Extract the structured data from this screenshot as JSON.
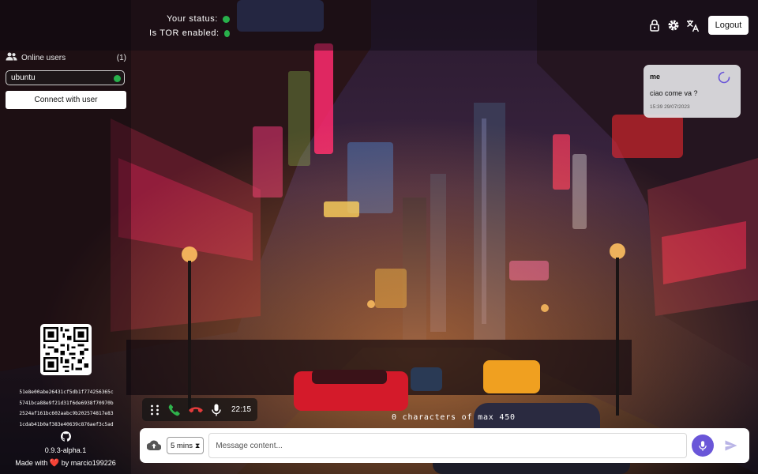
{
  "status": {
    "your_status_label": "Your status:",
    "tor_label": "Is TOR enabled:",
    "status_color": "#28b04b"
  },
  "header": {
    "icons": [
      "lock-icon",
      "gear-icon",
      "translate-icon"
    ],
    "logout_label": "Logout"
  },
  "sidebar": {
    "online_users_label": "Online users",
    "online_users_count": "(1)",
    "users": [
      {
        "name": "ubuntu",
        "online": true
      }
    ],
    "connect_label": "Connect with user",
    "hash_lines": [
      "51e8e00abe26431cf5db1f774256365c",
      "5741bca88e9f21d31f6de6938f70970b",
      "2524af161bc602aabc9b202574817e83",
      "1cdab41b0af383e40639c876aef3c5ad"
    ],
    "version": "0.9.3-alpha.1",
    "made_with_prefix": "Made with",
    "made_with_suffix": "by marcio199226"
  },
  "messages": [
    {
      "sender": "me",
      "text": "ciao come va ?",
      "time": "15:39 29/07/2023",
      "pending": true
    }
  ],
  "call": {
    "icons": [
      "dialpad-icon",
      "call-accept-icon",
      "call-end-icon",
      "microphone-icon"
    ],
    "duration": "22:15"
  },
  "composer": {
    "char_count_text": "0 characters of max 450",
    "expire_option": "5 mins",
    "placeholder": "Message content...",
    "accent_color": "#6a56d8"
  }
}
